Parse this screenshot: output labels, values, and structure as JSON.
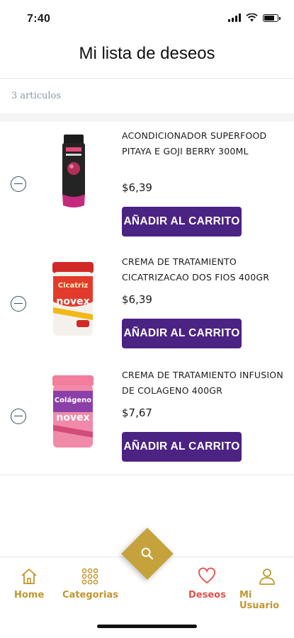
{
  "status_bar": {
    "time": "7:40",
    "battery_level": 0.85
  },
  "header": {
    "title": "Mi lista de deseos"
  },
  "summary": {
    "count_text": "3 articulos"
  },
  "products": [
    {
      "name": "ACONDICIONADOR SUPERFOOD PITAYA E GOJI BERRY 300ML",
      "price": "$6,39",
      "button_label": "AÑADIR AL CARRITO"
    },
    {
      "name": "CREMA DE TRATAMIENTO CICATRIZACAO DOS FIOS 400GR",
      "price": "$6,39",
      "button_label": "AÑADIR AL CARRITO"
    },
    {
      "name": "CREMA DE TRATAMIENTO INFUSION DE COLAGENO 400GR",
      "price": "$7,67",
      "button_label": "AÑADIR AL CARRITO"
    }
  ],
  "nav": {
    "home": "Home",
    "categories": "Categorias",
    "wishlist": "Deseos",
    "user": "Mi Usuario",
    "search_icon": "search-icon"
  },
  "colors": {
    "accent": "#4b2383",
    "gold": "#c2962e",
    "active": "#e0524a"
  }
}
